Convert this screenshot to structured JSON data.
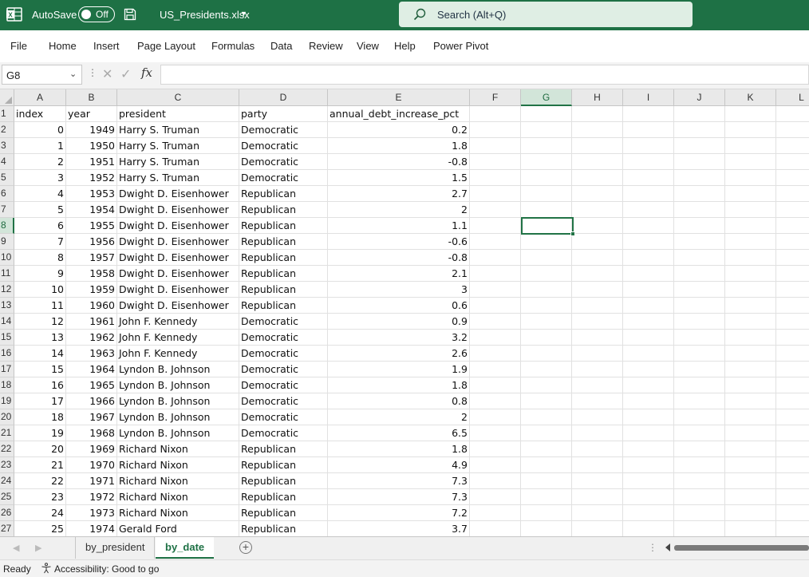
{
  "titlebar": {
    "app_icon": "excel-icon",
    "autosave_label": "AutoSave",
    "autosave_state": "Off",
    "save_icon": "save-icon",
    "filename": "US_Presidents.xlsx",
    "search_placeholder": "Search (Alt+Q)",
    "accent": "#1e7145"
  },
  "menu": [
    "File",
    "Home",
    "Insert",
    "Page Layout",
    "Formulas",
    "Data",
    "Review",
    "View",
    "Help",
    "Power Pivot"
  ],
  "formula_bar": {
    "name_box": "G8",
    "fx": "fx",
    "formula": ""
  },
  "sheet": {
    "columns": [
      "A",
      "B",
      "C",
      "D",
      "E",
      "F",
      "G",
      "H",
      "I",
      "J",
      "K",
      "L"
    ],
    "selected_column": "G",
    "selected_row": "8",
    "selected_cell": "G8",
    "header": [
      "index",
      "year",
      "president",
      "party",
      "annual_debt_increase_pct"
    ],
    "rows": [
      [
        "0",
        "1949",
        "Harry S. Truman",
        "Democratic",
        "0.2"
      ],
      [
        "1",
        "1950",
        "Harry S. Truman",
        "Democratic",
        "1.8"
      ],
      [
        "2",
        "1951",
        "Harry S. Truman",
        "Democratic",
        "-0.8"
      ],
      [
        "3",
        "1952",
        "Harry S. Truman",
        "Democratic",
        "1.5"
      ],
      [
        "4",
        "1953",
        "Dwight D. Eisenhower",
        "Republican",
        "2.7"
      ],
      [
        "5",
        "1954",
        "Dwight D. Eisenhower",
        "Republican",
        "2"
      ],
      [
        "6",
        "1955",
        "Dwight D. Eisenhower",
        "Republican",
        "1.1"
      ],
      [
        "7",
        "1956",
        "Dwight D. Eisenhower",
        "Republican",
        "-0.6"
      ],
      [
        "8",
        "1957",
        "Dwight D. Eisenhower",
        "Republican",
        "-0.8"
      ],
      [
        "9",
        "1958",
        "Dwight D. Eisenhower",
        "Republican",
        "2.1"
      ],
      [
        "10",
        "1959",
        "Dwight D. Eisenhower",
        "Republican",
        "3"
      ],
      [
        "11",
        "1960",
        "Dwight D. Eisenhower",
        "Republican",
        "0.6"
      ],
      [
        "12",
        "1961",
        "John F. Kennedy",
        "Democratic",
        "0.9"
      ],
      [
        "13",
        "1962",
        "John F. Kennedy",
        "Democratic",
        "3.2"
      ],
      [
        "14",
        "1963",
        "John F. Kennedy",
        "Democratic",
        "2.6"
      ],
      [
        "15",
        "1964",
        "Lyndon B. Johnson",
        "Democratic",
        "1.9"
      ],
      [
        "16",
        "1965",
        "Lyndon B. Johnson",
        "Democratic",
        "1.8"
      ],
      [
        "17",
        "1966",
        "Lyndon B. Johnson",
        "Democratic",
        "0.8"
      ],
      [
        "18",
        "1967",
        "Lyndon B. Johnson",
        "Democratic",
        "2"
      ],
      [
        "19",
        "1968",
        "Lyndon B. Johnson",
        "Democratic",
        "6.5"
      ],
      [
        "20",
        "1969",
        "Richard Nixon",
        "Republican",
        "1.8"
      ],
      [
        "21",
        "1970",
        "Richard Nixon",
        "Republican",
        "4.9"
      ],
      [
        "22",
        "1971",
        "Richard Nixon",
        "Republican",
        "7.3"
      ],
      [
        "23",
        "1972",
        "Richard Nixon",
        "Republican",
        "7.3"
      ],
      [
        "24",
        "1973",
        "Richard Nixon",
        "Republican",
        "7.2"
      ],
      [
        "25",
        "1974",
        "Gerald Ford",
        "Republican",
        "3.7"
      ]
    ]
  },
  "tabs": {
    "items": [
      "by_president",
      "by_date"
    ],
    "active": "by_date",
    "add_icon": "add-sheet-icon"
  },
  "status": {
    "ready": "Ready",
    "accessibility": "Accessibility: Good to go",
    "accessibility_icon": "accessibility-icon"
  }
}
